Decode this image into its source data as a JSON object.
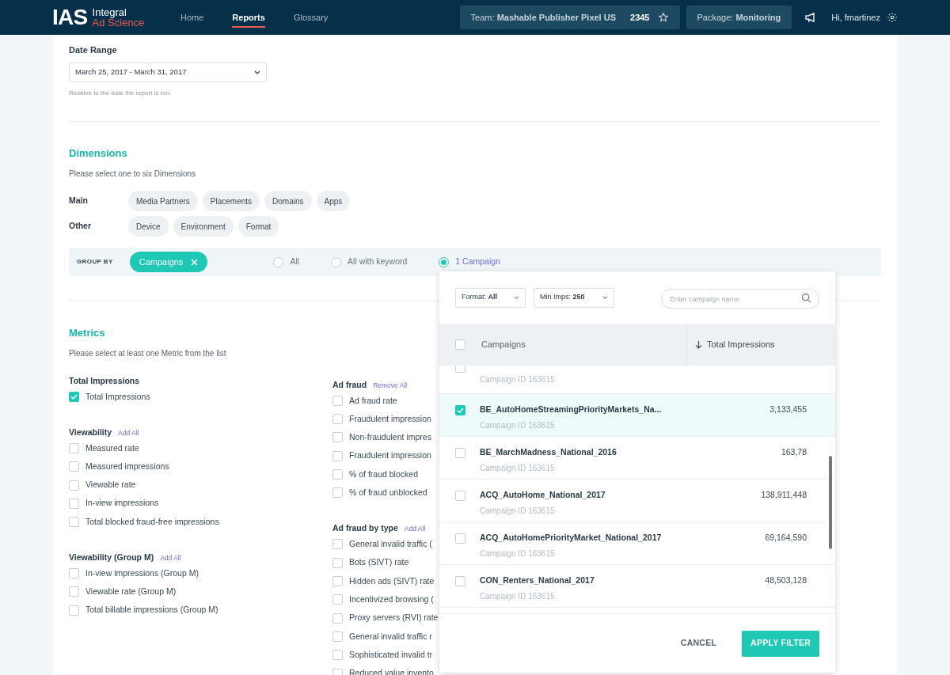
{
  "header": {
    "logo": {
      "mark": "IAS",
      "line1": "Integral",
      "line2": "Ad Science"
    },
    "nav": [
      {
        "label": "Home",
        "selected": false
      },
      {
        "label": "Reports",
        "selected": true
      },
      {
        "label": "Glossary",
        "selected": false
      }
    ],
    "team": {
      "label": "Team: **Mashable Publisher Pixel US**",
      "count": "2345"
    },
    "package": "Package: **Monitoring**",
    "greeting": "Hi, fmartinez"
  },
  "date_range": {
    "label": "Date Range",
    "value": "March 25, 2017 - March 31, 2017",
    "hint": "Relative to the date the report is run."
  },
  "dimensions": {
    "title": "Dimensions",
    "subtitle": "Please select one to six Dimensions",
    "groups": [
      {
        "label": "Main",
        "chips": [
          "Media Partners",
          "Placements",
          "Domains",
          "Apps"
        ]
      },
      {
        "label": "Other",
        "chips": [
          "Device",
          "Environment",
          "Format"
        ]
      }
    ]
  },
  "group_by": {
    "label": "GROUP BY",
    "chip": "Campaigns",
    "options": [
      {
        "label": "All",
        "selected": false
      },
      {
        "label": "All with keyword",
        "selected": false
      },
      {
        "label": "1 Campaign",
        "selected": true
      }
    ]
  },
  "metrics": {
    "title": "Metrics",
    "subtitle": "Please select at least one Metric from the list",
    "columns": [
      [
        {
          "title": "Total Impressions",
          "items": [
            {
              "label": "Total Impressions",
              "checked": true
            }
          ]
        },
        {
          "title": "Viewability",
          "action": "Add All",
          "items": [
            {
              "label": "Measured rate",
              "checked": false
            },
            {
              "label": "Measured impressions",
              "checked": false
            },
            {
              "label": "Viewable rate",
              "checked": false
            },
            {
              "label": "In-view impressions",
              "checked": false
            },
            {
              "label": "Total blocked fraud-free impressions",
              "checked": false
            }
          ]
        },
        {
          "title": "Viewability (Group M)",
          "action": "Add All",
          "items": [
            {
              "label": "In-view impressions (Group M)",
              "checked": false
            },
            {
              "label": "Viewable rate (Group M)",
              "checked": false
            },
            {
              "label": "Total billable impressions (Group M)",
              "checked": false
            }
          ]
        }
      ],
      [
        {
          "title": "Ad fraud",
          "action": "Remove All",
          "items": [
            {
              "label": "Ad fraud rate",
              "checked": false
            },
            {
              "label": "Fraudulent impression",
              "checked": false
            },
            {
              "label": "Non-fraudulent impres",
              "checked": false
            },
            {
              "label": "Fraudulent impression",
              "checked": false
            },
            {
              "label": "% of fraud blocked",
              "checked": false
            },
            {
              "label": "% of fraud unblocked",
              "checked": false
            }
          ]
        },
        {
          "title": "Ad fraud by type",
          "action": "Add All",
          "items": [
            {
              "label": "General invalid traffic (",
              "checked": false
            },
            {
              "label": "Bots (SIVT) rate",
              "checked": false
            },
            {
              "label": "Hidden ads (SIVT) rate",
              "checked": false
            },
            {
              "label": "Incentivized browsing (",
              "checked": false
            },
            {
              "label": "Proxy servers (RVI) rate",
              "checked": false
            },
            {
              "label": "General invalid traffic r",
              "checked": false
            },
            {
              "label": "Sophisticated invalid tr",
              "checked": false
            },
            {
              "label": "Reduced value invento",
              "checked": false
            }
          ]
        }
      ]
    ]
  },
  "campaign_popover": {
    "format": "Format: **All**",
    "min_imps": "Min Imps: **250**",
    "search_placeholder": "Enter campaign name",
    "columns": [
      "Campaigns",
      "Total Impressions"
    ],
    "all_checked": false,
    "rows": [
      {
        "id": "Campaign ID 163615",
        "checked": false,
        "selected": false
      },
      {
        "name": "BE_AutoHomeStreamingPriorityMarkets_Na...",
        "id": "Campaign ID 163615",
        "impressions": "3,133,455",
        "checked": true,
        "selected": true
      },
      {
        "name": "BE_MarchMadness_National_2016",
        "id": "Campaign ID 163615",
        "impressions": "163,78",
        "checked": false,
        "selected": false
      },
      {
        "name": "ACQ_AutoHome_National_2017",
        "id": "Campaign ID 163615",
        "impressions": "138,911,448",
        "checked": false,
        "selected": false
      },
      {
        "name": "ACQ_AutoHomePriorityMarket_National_2017",
        "id": "Campaign ID 163615",
        "impressions": "69,164,590",
        "checked": false,
        "selected": false
      },
      {
        "name": "CON_Renters_National_2017",
        "id": "Campaign ID 163615",
        "impressions": "48,503,128",
        "checked": false,
        "selected": false
      }
    ],
    "cancel": "CANCEL",
    "apply": "APPLY FILTER"
  }
}
